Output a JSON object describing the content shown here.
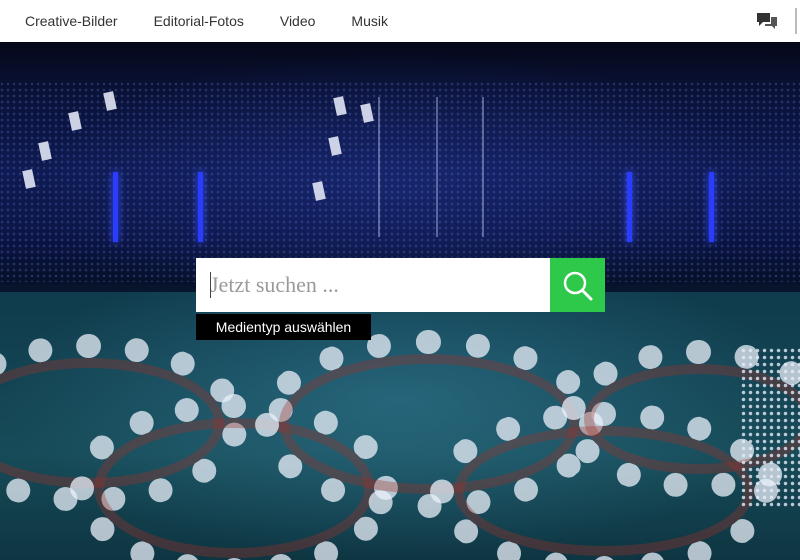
{
  "nav": {
    "items": [
      {
        "label": "Creative-Bilder"
      },
      {
        "label": "Editorial-Fotos"
      },
      {
        "label": "Video"
      },
      {
        "label": "Musik"
      }
    ],
    "chat_icon": "chat-bubbles-icon"
  },
  "search": {
    "placeholder": "Jetzt suchen ...",
    "button_icon": "search-icon",
    "media_type_label": "Medientyp auswählen"
  },
  "colors": {
    "search_button": "#2ec84a",
    "topbar": "#ffffff",
    "media_button": "#000000"
  }
}
